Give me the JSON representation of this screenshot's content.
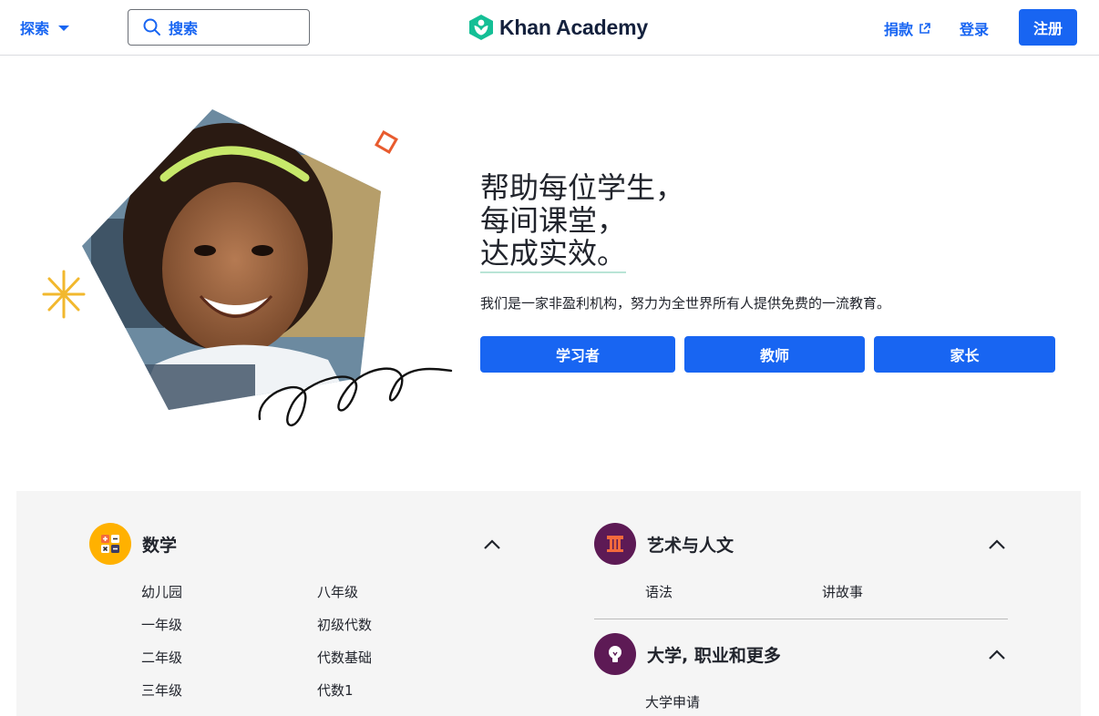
{
  "header": {
    "explore_label": "探索",
    "search_placeholder": "搜索",
    "logo_text": "Khan Academy",
    "donate_label": "捐款",
    "login_label": "登录",
    "signup_label": "注册"
  },
  "hero": {
    "headline_lines": [
      "帮助每位学生，",
      "每间课堂，",
      "达成实效。"
    ],
    "subtitle": "我们是一家非盈利机构，努力为全世界所有人提供免费的一流教育。",
    "buttons": [
      "学习者",
      "教师",
      "家长"
    ]
  },
  "subjects": {
    "math": {
      "title": "数学",
      "links": [
        "幼儿园",
        "一年级",
        "二年级",
        "三年级",
        "八年级",
        "初级代数",
        "代数基础",
        "代数1"
      ]
    },
    "arts": {
      "title": "艺术与人文",
      "links": [
        "语法",
        "讲故事"
      ]
    },
    "college": {
      "title": "大学, 职业和更多",
      "links": [
        "大学申请"
      ]
    }
  },
  "colors": {
    "brand_blue": "#1865f2",
    "math_icon_bg": "#ffb100",
    "arts_icon_bg": "#5d1a55",
    "college_icon_bg": "#5d1a55",
    "logo_green": "#14bf96"
  },
  "icons": {
    "explore": "chevron-down-icon",
    "search": "search-icon",
    "donate": "external-link-icon",
    "math": "calculator-icon",
    "arts": "column-icon",
    "college": "lightbulb-icon",
    "collapse": "chevron-up-icon"
  }
}
